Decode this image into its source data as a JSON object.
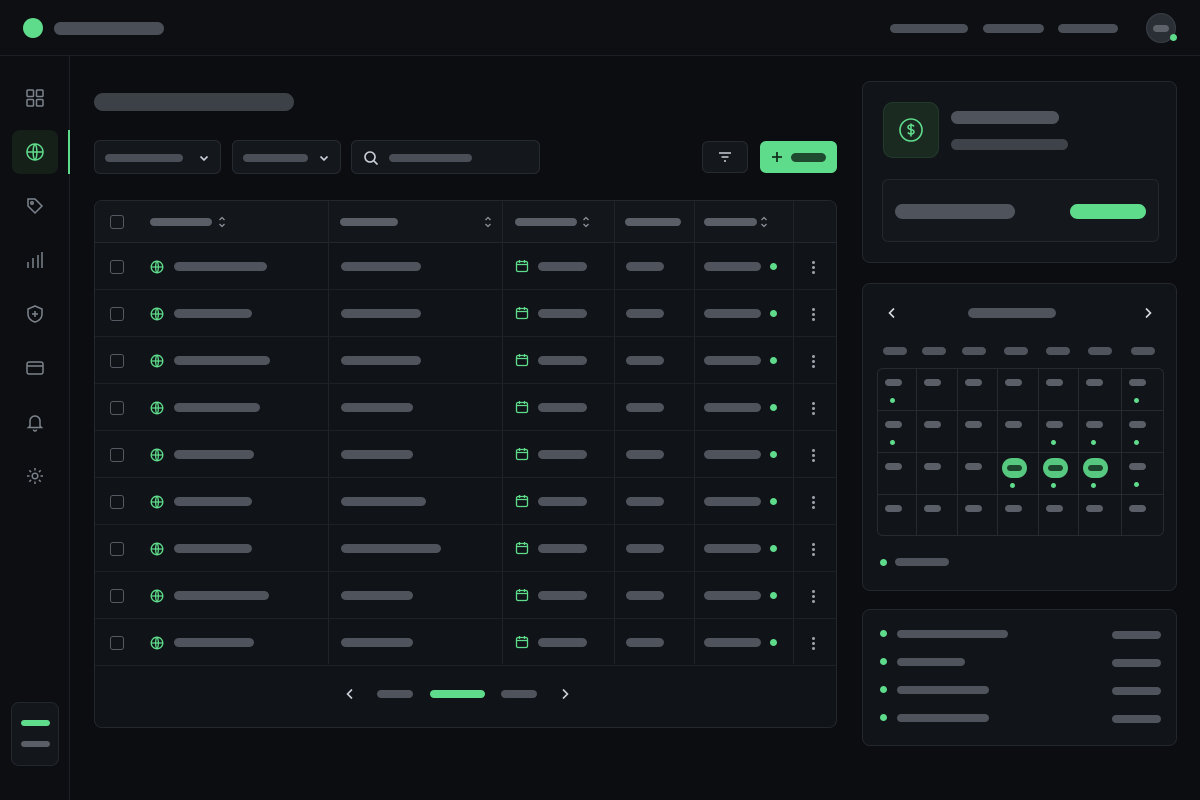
{
  "topbar": {
    "nav_links": [
      "",
      "",
      ""
    ],
    "avatar_status": "online"
  },
  "sidebar": {
    "items": [
      {
        "icon": "grid-icon",
        "active": false
      },
      {
        "icon": "globe-icon",
        "active": true
      },
      {
        "icon": "tag-icon",
        "active": false
      },
      {
        "icon": "bar-chart-icon",
        "active": false
      },
      {
        "icon": "shield-plus-icon",
        "active": false
      },
      {
        "icon": "credit-card-icon",
        "active": false
      },
      {
        "icon": "bell-icon",
        "active": false
      },
      {
        "icon": "gear-icon",
        "active": false
      }
    ]
  },
  "toolbar": {
    "add_icon": "plus-icon",
    "filter_icon": "filter-icon",
    "search_icon": "search-icon"
  },
  "table": {
    "columns": 5,
    "sortable_columns": [
      0,
      1,
      2,
      4
    ],
    "row_count": 9,
    "row_icons": {
      "domain": "globe-icon",
      "date": "calendar-icon",
      "status": "status-dot"
    },
    "pagination": {
      "pages": 3,
      "current": 2
    }
  },
  "billing_card": {
    "icon": "dollar-icon"
  },
  "calendar": {
    "selected_days": [
      [
        2,
        3
      ],
      [
        2,
        4
      ],
      [
        2,
        5
      ]
    ],
    "event_dots": [
      [
        0,
        0
      ],
      [
        0,
        6
      ],
      [
        1,
        0
      ],
      [
        1,
        4
      ],
      [
        1,
        5
      ],
      [
        1,
        6
      ],
      [
        2,
        3
      ],
      [
        2,
        4
      ],
      [
        2,
        5
      ],
      [
        2,
        6
      ]
    ]
  },
  "list_card": {
    "items": 4
  },
  "colors": {
    "accent": "#5fdc8b",
    "background": "#0b0d10",
    "panel": "#111418",
    "border": "#23272e"
  }
}
